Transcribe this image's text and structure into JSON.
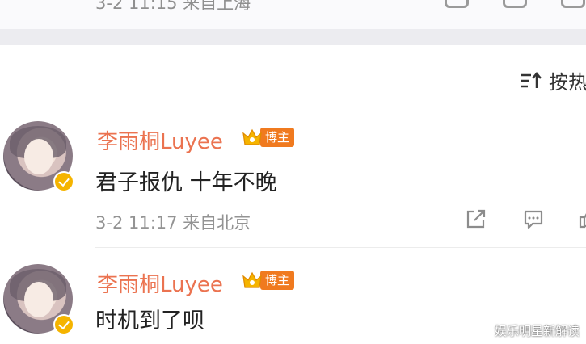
{
  "previous_comment": {
    "meta": "3-2 11:15 来自上海"
  },
  "sort": {
    "label": "按热"
  },
  "comments": [
    {
      "username": "李雨桐Luyee",
      "badge": "博主",
      "text": "君子报仇 十年不晚",
      "meta": "3-2 11:17 来自北京"
    },
    {
      "username": "李雨桐Luyee",
      "badge": "博主",
      "text": "时机到了呗"
    }
  ],
  "watermark": "娱乐明星新解读",
  "colors": {
    "username": "#eb7350",
    "badge": "#f07a1f",
    "verified": "#f5b400",
    "meta": "#939393"
  }
}
